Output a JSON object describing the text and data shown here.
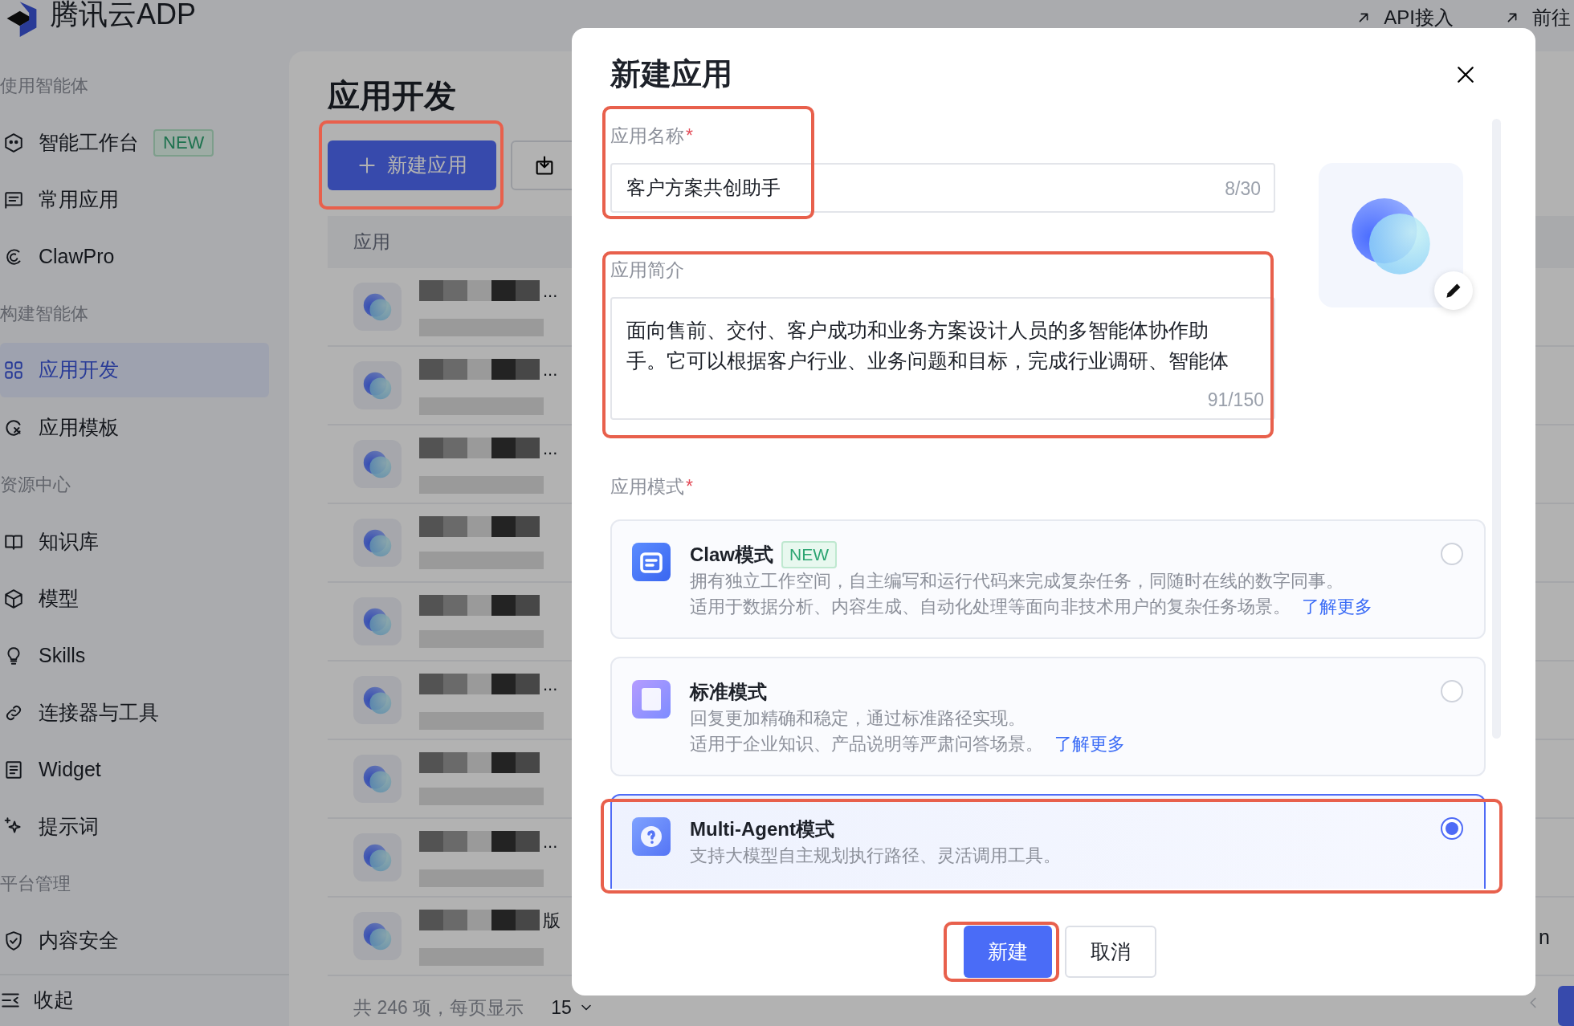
{
  "brand": {
    "name": "腾讯云ADP"
  },
  "top_links": [
    {
      "label": "API接入"
    },
    {
      "label": "前往"
    }
  ],
  "sidebar": {
    "sections": [
      {
        "title": "使用智能体",
        "items": [
          {
            "label": "智能工作台",
            "badge": "NEW",
            "selected": false
          },
          {
            "label": "常用应用",
            "selected": false
          },
          {
            "label": "ClawPro",
            "selected": false
          }
        ]
      },
      {
        "title": "构建智能体",
        "items": [
          {
            "label": "应用开发",
            "selected": true
          },
          {
            "label": "应用模板",
            "selected": false
          }
        ]
      },
      {
        "title": "资源中心",
        "items": [
          {
            "label": "知识库",
            "selected": false
          },
          {
            "label": "模型",
            "selected": false
          },
          {
            "label": "Skills",
            "selected": false
          },
          {
            "label": "连接器与工具",
            "selected": false
          },
          {
            "label": "Widget",
            "selected": false
          },
          {
            "label": "提示词",
            "selected": false
          }
        ]
      },
      {
        "title": "平台管理",
        "items": [
          {
            "label": "内容安全",
            "selected": false
          }
        ]
      }
    ],
    "collapse": "收起"
  },
  "page": {
    "title": "应用开发",
    "new_button": {
      "label": "新建应用",
      "highlighted": true
    },
    "table": {
      "columns": [
        "应用"
      ],
      "rows": [
        {
          "redacted": true,
          "suffix": "..."
        },
        {
          "redacted": true,
          "suffix": "..."
        },
        {
          "redacted": true,
          "suffix": "..."
        },
        {
          "redacted": true
        },
        {
          "redacted": true
        },
        {
          "redacted": true,
          "suffix": "..."
        },
        {
          "redacted": true
        },
        {
          "redacted": true,
          "suffix": "..."
        },
        {
          "redacted": true,
          "suffix": "版"
        }
      ],
      "side_fragment": "n"
    },
    "pagination": {
      "total": "共 246 项，每页显示",
      "page_size": "15"
    }
  },
  "dialog": {
    "title": "新建应用",
    "name_field": {
      "label": "应用名称",
      "required_mark": "*",
      "value": "客户方案共创助手",
      "counter": "8/30",
      "highlighted": true
    },
    "description_field": {
      "label": "应用简介",
      "value": "面向售前、交付、客户成功和业务方案设计人员的多智能体协作助手。它可以根据客户行业、业务问题和目标，完成行业调研、智能体",
      "counter": "91/150",
      "highlighted": true
    },
    "mode": {
      "label": "应用模式",
      "required_mark": "*",
      "options": [
        {
          "title": "Claw模式",
          "badge": "NEW",
          "lines": [
            "拥有独立工作空间，自主编写和运行代码来完成复杂任务，同随时在线的数字同事。",
            "适用于数据分析、内容生成、自动化处理等面向非技术用户的复杂任务场景。"
          ],
          "link": "了解更多",
          "selected": false,
          "highlighted": false
        },
        {
          "title": "标准模式",
          "lines": [
            "回复更加精确和稳定，通过标准路径实现。",
            "适用于企业知识、产品说明等严肃问答场景。"
          ],
          "link": "了解更多",
          "selected": false,
          "highlighted": false
        },
        {
          "title": "Multi-Agent模式",
          "lines": [
            "支持大模型自主规划执行路径、灵活调用工具。"
          ],
          "selected": true,
          "highlighted": true
        }
      ]
    },
    "buttons": [
      {
        "label": "新建",
        "kind": "primary",
        "highlighted": true
      },
      {
        "label": "取消",
        "kind": "secondary",
        "highlighted": false
      }
    ]
  }
}
